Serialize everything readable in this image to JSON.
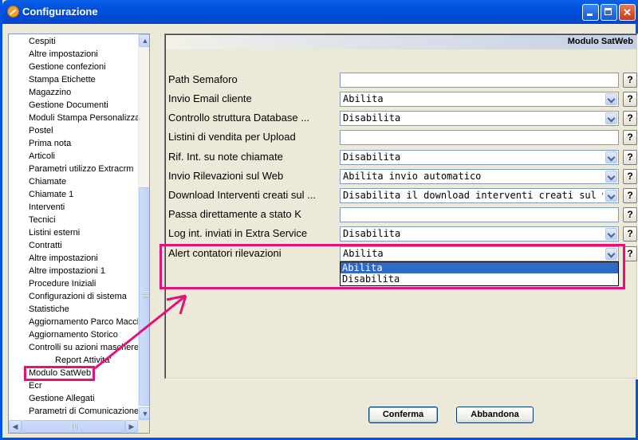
{
  "window": {
    "title": "Configurazione"
  },
  "tree": {
    "items": [
      {
        "label": "Cespiti"
      },
      {
        "label": "Altre impostazioni"
      },
      {
        "label": "Gestione confezioni"
      },
      {
        "label": "Stampa Etichette"
      },
      {
        "label": "Magazzino"
      },
      {
        "label": "Gestione Documenti"
      },
      {
        "label": "Moduli Stampa Personalizzat"
      },
      {
        "label": "Postel"
      },
      {
        "label": "Prima nota"
      },
      {
        "label": "Articoli"
      },
      {
        "label": "Parametri utilizzo Extracrm"
      },
      {
        "label": "Chiamate"
      },
      {
        "label": "Chiamate 1"
      },
      {
        "label": "Interventi"
      },
      {
        "label": "Tecnici"
      },
      {
        "label": "Listini esterni"
      },
      {
        "label": "Contratti"
      },
      {
        "label": "Altre impostazioni"
      },
      {
        "label": "Altre impostazioni 1"
      },
      {
        "label": "Procedure Iniziali"
      },
      {
        "label": "Configurazioni di sistema"
      },
      {
        "label": "Statistiche"
      },
      {
        "label": "Aggiornamento Parco Macch"
      },
      {
        "label": "Aggiornamento Storico"
      },
      {
        "label": "Controlli su azioni maschere"
      },
      {
        "label": "Report Attivita'"
      },
      {
        "label": "Modulo SatWeb"
      },
      {
        "label": "Ecr"
      },
      {
        "label": "Gestione Allegati"
      },
      {
        "label": "Parametri di Comunicazione"
      }
    ]
  },
  "panel": {
    "header": "Modulo SatWeb",
    "rows": [
      {
        "label": "Path Semaforo",
        "value": ""
      },
      {
        "label": "Invio Email cliente",
        "value": "Abilita"
      },
      {
        "label": "Controllo struttura Database ...",
        "value": "Disabilita"
      },
      {
        "label": "Listini di vendita per Upload",
        "value": ""
      },
      {
        "label": "Rif. Int. su note chiamate",
        "value": "Disabilita"
      },
      {
        "label": "Invio Rilevazioni sul Web",
        "value": "Abilita invio automatico"
      },
      {
        "label": "Download Interventi creati sul ...",
        "value": "Disabilita il download interventi creati sul web"
      },
      {
        "label": "Passa direttamente a stato K",
        "value": ""
      },
      {
        "label": "Log int. inviati in Extra Service",
        "value": "Disabilita"
      },
      {
        "label": "Alert contatori rilevazioni",
        "value": "Abilita"
      }
    ],
    "help_label": "?",
    "dropdown_options": [
      {
        "label": "Abilita",
        "selected": true
      },
      {
        "label": "Disabilita",
        "selected": false
      }
    ]
  },
  "buttons": {
    "confirm": "Conferma",
    "cancel": "Abbandona"
  },
  "colors": {
    "highlight": "#e4117a",
    "titlebar": "#0050dc",
    "selection": "#316ac5"
  }
}
